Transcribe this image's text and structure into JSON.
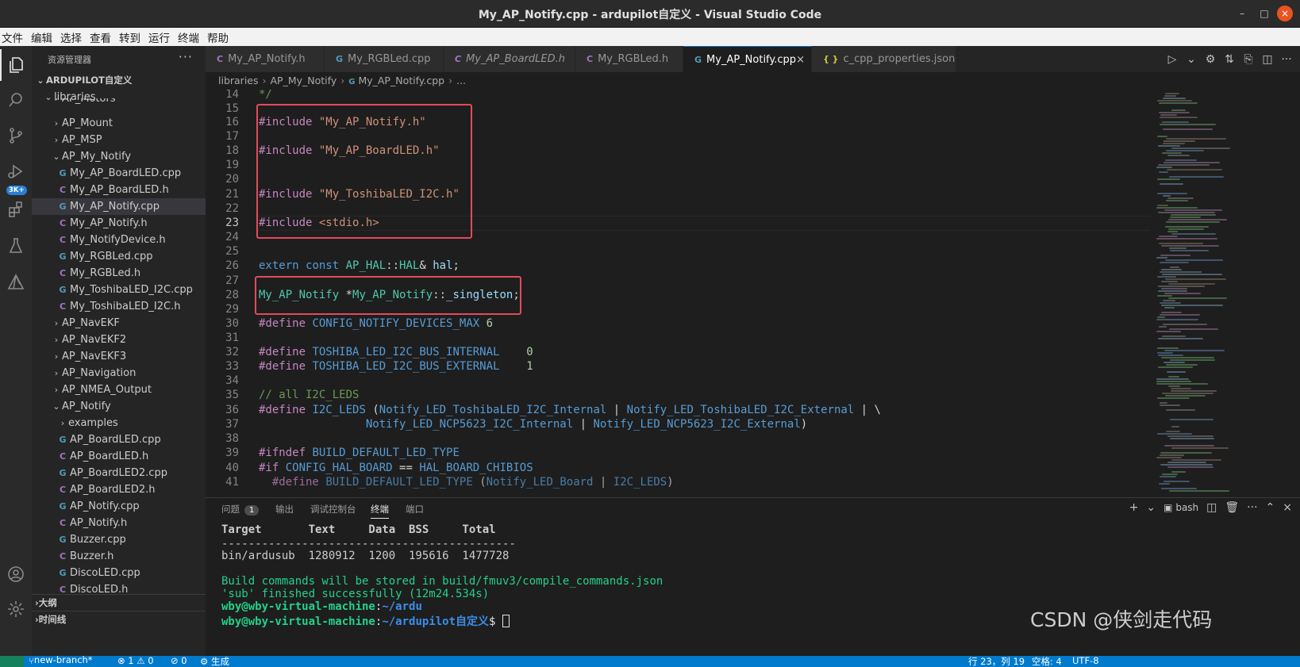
{
  "window": {
    "title": "My_AP_Notify.cpp - ardupilot自定义 - Visual Studio Code",
    "minimize": "–",
    "maximize": "□",
    "close": "×"
  },
  "menu": [
    "文件",
    "编辑",
    "选择",
    "查看",
    "转到",
    "运行",
    "终端",
    "帮助"
  ],
  "activity": {
    "badge": "3K+"
  },
  "explorer": {
    "header": "资源管理器",
    "more": "···",
    "root": "ARDUPILOT自定义",
    "items": [
      {
        "label": "libraries",
        "kind": "folder-open",
        "depth": 1
      },
      {
        "label": "AP_Motors",
        "kind": "folder",
        "depth": 2
      },
      {
        "label": "AP_Mount",
        "kind": "folder",
        "depth": 2
      },
      {
        "label": "AP_MSP",
        "kind": "folder",
        "depth": 2
      },
      {
        "label": "AP_My_Notify",
        "kind": "folder-open",
        "depth": 2
      },
      {
        "label": "My_AP_BoardLED.cpp",
        "kind": "cpp",
        "depth": 3
      },
      {
        "label": "My_AP_BoardLED.h",
        "kind": "h",
        "depth": 3
      },
      {
        "label": "My_AP_Notify.cpp",
        "kind": "cpp",
        "depth": 3,
        "selected": true
      },
      {
        "label": "My_AP_Notify.h",
        "kind": "h",
        "depth": 3
      },
      {
        "label": "My_NotifyDevice.h",
        "kind": "h",
        "depth": 3
      },
      {
        "label": "My_RGBLed.cpp",
        "kind": "cpp",
        "depth": 3
      },
      {
        "label": "My_RGBLed.h",
        "kind": "h",
        "depth": 3
      },
      {
        "label": "My_ToshibaLED_I2C.cpp",
        "kind": "cpp",
        "depth": 3
      },
      {
        "label": "My_ToshibaLED_I2C.h",
        "kind": "h",
        "depth": 3
      },
      {
        "label": "AP_NavEKF",
        "kind": "folder",
        "depth": 2
      },
      {
        "label": "AP_NavEKF2",
        "kind": "folder",
        "depth": 2
      },
      {
        "label": "AP_NavEKF3",
        "kind": "folder",
        "depth": 2
      },
      {
        "label": "AP_Navigation",
        "kind": "folder",
        "depth": 2
      },
      {
        "label": "AP_NMEA_Output",
        "kind": "folder",
        "depth": 2
      },
      {
        "label": "AP_Notify",
        "kind": "folder-open",
        "depth": 2
      },
      {
        "label": "examples",
        "kind": "folder",
        "depth": 3
      },
      {
        "label": "AP_BoardLED.cpp",
        "kind": "cpp",
        "depth": 3
      },
      {
        "label": "AP_BoardLED.h",
        "kind": "h",
        "depth": 3
      },
      {
        "label": "AP_BoardLED2.cpp",
        "kind": "cpp",
        "depth": 3
      },
      {
        "label": "AP_BoardLED2.h",
        "kind": "h",
        "depth": 3
      },
      {
        "label": "AP_Notify.cpp",
        "kind": "cpp",
        "depth": 3
      },
      {
        "label": "AP_Notify.h",
        "kind": "h",
        "depth": 3
      },
      {
        "label": "Buzzer.cpp",
        "kind": "cpp",
        "depth": 3
      },
      {
        "label": "Buzzer.h",
        "kind": "h",
        "depth": 3
      },
      {
        "label": "DiscoLED.cpp",
        "kind": "cpp",
        "depth": 3
      },
      {
        "label": "DiscoLED.h",
        "kind": "h",
        "depth": 3
      }
    ],
    "outline": "大纲",
    "timeline": "时间线"
  },
  "tabs": [
    {
      "label": "My_AP_Notify.h",
      "kind": "h",
      "icon": "C"
    },
    {
      "label": "My_RGBLed.cpp",
      "kind": "cpp",
      "icon": "G"
    },
    {
      "label": "My_AP_BoardLED.h",
      "kind": "h",
      "icon": "C"
    },
    {
      "label": "My_RGBLed.h",
      "kind": "h",
      "icon": "C"
    },
    {
      "label": "My_AP_Notify.cpp",
      "kind": "cpp",
      "icon": "G",
      "active": true
    },
    {
      "label": "c_cpp_properties.json",
      "kind": "json",
      "icon": "{ }"
    }
  ],
  "tab_close": "×",
  "breadcrumb": [
    "libraries",
    "AP_My_Notify",
    "My_AP_Notify.cpp",
    "..."
  ],
  "editor": {
    "line_numbers": [
      "14",
      "15",
      "16",
      "17",
      "18",
      "19",
      "20",
      "21",
      "22",
      "23",
      "24",
      "25",
      "26",
      "27",
      "28",
      "29",
      "30",
      "31",
      "32",
      "33",
      "34",
      "35",
      "36",
      "37",
      "38",
      "39",
      "40",
      "41"
    ],
    "current_line": "23",
    "lines": {
      "l14": "*/",
      "l16a": "#include",
      "l16b": "\"My_AP_Notify.h\"",
      "l18a": "#include",
      "l18b": "\"My_AP_BoardLED.h\"",
      "l21a": "#include",
      "l21b": "\"My_ToshibaLED_I2C.h\"",
      "l23a": "#include",
      "l23b": "<stdio.h>",
      "l26a": "extern",
      "l26b": "const",
      "l26c": "AP_HAL",
      "l26d": "::",
      "l26e": "HAL",
      "l26f": "&",
      "l26g": "hal",
      "l26h": ";",
      "l28a": "My_AP_Notify",
      "l28b": " *",
      "l28c": "My_AP_Notify",
      "l28d": "::",
      "l28e": "_singleton",
      "l28f": ";",
      "l30a": "#define",
      "l30b": "CONFIG_NOTIFY_DEVICES_MAX",
      "l30c": "6",
      "l32a": "#define",
      "l32b": "TOSHIBA_LED_I2C_BUS_INTERNAL",
      "l32c": "0",
      "l33a": "#define",
      "l33b": "TOSHIBA_LED_I2C_BUS_EXTERNAL",
      "l33c": "1",
      "l35": "// all I2C_LEDS",
      "l36a": "#define",
      "l36b": "I2C_LEDS",
      "l36c": "(",
      "l36d": "Notify_LED_ToshibaLED_I2C_Internal",
      "l36e": "|",
      "l36f": "Notify_LED_ToshibaLED_I2C_External",
      "l36g": "|",
      "l36h": "\\",
      "l37a": "Notify_LED_NCP5623_I2C_Internal",
      "l37b": "|",
      "l37c": "Notify_LED_NCP5623_I2C_External",
      "l37d": ")",
      "l39a": "#ifndef",
      "l39b": "BUILD_DEFAULT_LED_TYPE",
      "l40a": "#if",
      "l40b": "CONFIG_HAL_BOARD",
      "l40c": "==",
      "l40d": "HAL_BOARD_CHIBIOS",
      "l41a": "#define",
      "l41b": "BUILD_DEFAULT_LED_TYPE",
      "l41c": "(",
      "l41d": "Notify_LED_Board",
      "l41e": "|",
      "l41f": "I2C_LEDS",
      "l41g": ")"
    }
  },
  "panel": {
    "tabs": [
      {
        "label": "问题",
        "count": "1"
      },
      {
        "label": "输出"
      },
      {
        "label": "调试控制台"
      },
      {
        "label": "终端",
        "active": true
      },
      {
        "label": "端口"
      }
    ],
    "shell": "bash",
    "terminal": {
      "header": "Target       Text     Data  BSS     Total",
      "rule": "--------------------------------------------",
      "row": "bin/ardusub  1280912  1200  195616  1477728",
      "msg1": "Build commands will be stored in build/fmuv3/compile_commands.json",
      "msg2": "'sub' finished successfully (12m24.534s)",
      "user": "wby@wby-virtual-machine",
      "path1": "~/ardu",
      "path2": "~/ardupilot自定义",
      "prompt_end": "$"
    }
  },
  "status": {
    "branch": "new-branch*",
    "errors": "⊗ 1 ⚠ 0",
    "ports": "⊘ 0",
    "build": "⚙ 生成",
    "position": "行 23，列 19",
    "spaces": "空格: 4",
    "encoding": "UTF-8"
  },
  "watermark": "CSDN @侠剑走代码"
}
